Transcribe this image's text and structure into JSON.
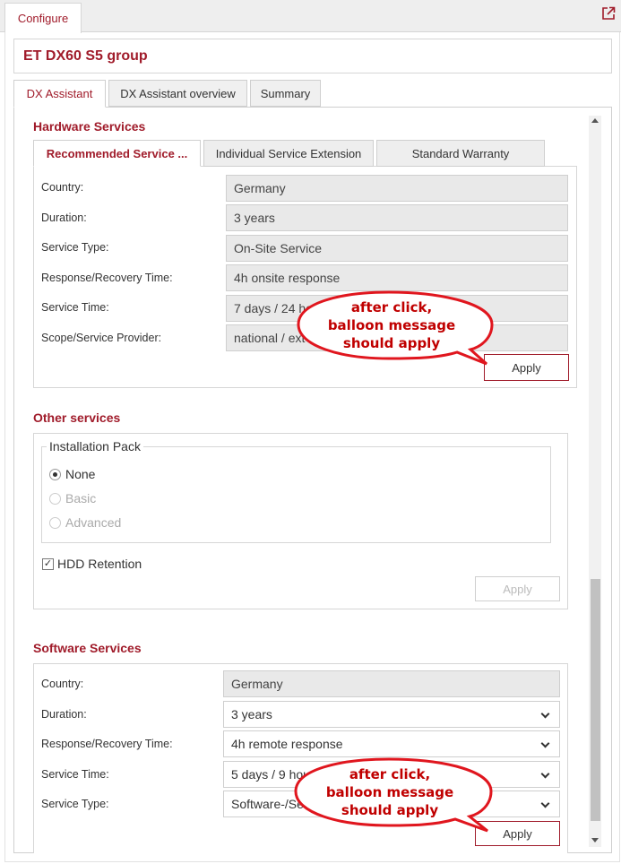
{
  "top_tab": {
    "label": "Configure"
  },
  "title": "ET DX60 S5 group",
  "main_tabs": [
    {
      "label": "DX Assistant"
    },
    {
      "label": "DX Assistant overview"
    },
    {
      "label": "Summary"
    }
  ],
  "hardware": {
    "title": "Hardware Services",
    "tabs": [
      {
        "label": "Recommended Service ..."
      },
      {
        "label": "Individual Service Extension"
      },
      {
        "label": "Standard Warranty"
      }
    ],
    "rows": [
      {
        "label": "Country:",
        "value": "Germany"
      },
      {
        "label": "Duration:",
        "value": "3 years"
      },
      {
        "label": "Service Type:",
        "value": "On-Site Service"
      },
      {
        "label": "Response/Recovery Time:",
        "value": "4h onsite response"
      },
      {
        "label": "Service Time:",
        "value": "7 days / 24 ho"
      },
      {
        "label": "Scope/Service Provider:",
        "value": "national / ext"
      }
    ],
    "apply_label": "Apply"
  },
  "other": {
    "title": "Other services",
    "group_legend": "Installation Pack",
    "options": [
      {
        "label": "None",
        "selected": true,
        "disabled": false
      },
      {
        "label": "Basic",
        "selected": false,
        "disabled": true
      },
      {
        "label": "Advanced",
        "selected": false,
        "disabled": true
      }
    ],
    "hdd_label": "HDD Retention",
    "hdd_checked": true,
    "apply_label": "Apply"
  },
  "software": {
    "title": "Software Services",
    "rows": [
      {
        "label": "Country:",
        "value": "Germany"
      },
      {
        "label": "Duration:",
        "value": "3 years"
      },
      {
        "label": "Response/Recovery Time:",
        "value": "4h remote response"
      },
      {
        "label": "Service Time:",
        "value": "5 days / 9 hou"
      },
      {
        "label": "Service Type:",
        "value": "Software-/Se"
      }
    ],
    "apply_label": "Apply"
  },
  "balloons": [
    {
      "line1": "after click,",
      "line2": "balloon message",
      "line3": "should apply"
    },
    {
      "line1": "after click,",
      "line2": "balloon message",
      "line3": "should apply"
    }
  ],
  "colors": {
    "accent": "#a01b2a",
    "balloon": "#e0161e"
  },
  "icons": {
    "popout": "external-link-icon",
    "chevron": "chevron-down-icon"
  }
}
